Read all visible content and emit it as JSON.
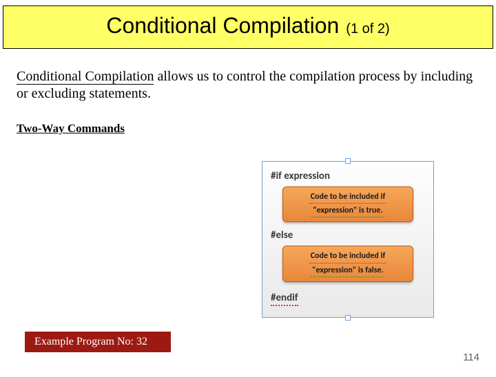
{
  "title": {
    "main": "Conditional Compilation",
    "sub": "(1 of 2)"
  },
  "intro": {
    "lead": "Conditional Compilation",
    "rest": " allows us to control the compilation process by including or excluding statements."
  },
  "section_heading": "Two-Way Commands",
  "diagram": {
    "d1": "#if expression",
    "box1_l1": "Code to be included if",
    "box1_l2": "\"expression\" is true.",
    "d2": "#else",
    "box2_l1": "Code to be included if",
    "box2_l2": "\"expression\" is false.",
    "d3": "#endif"
  },
  "example_badge": "Example Program No: 32",
  "page_number": "114"
}
